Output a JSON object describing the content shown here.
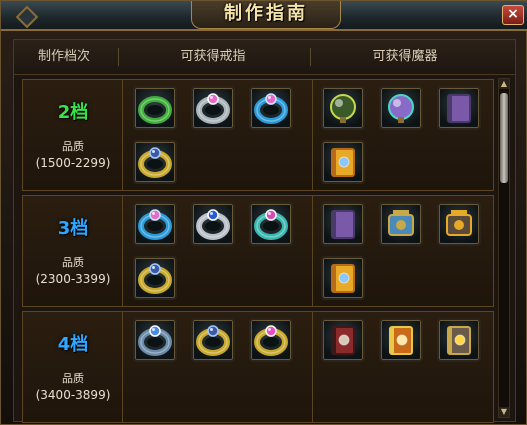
{
  "window": {
    "title": "制作指南",
    "close_label": "×"
  },
  "header": {
    "col_tier": "制作档次",
    "col_rings": "可获得戒指",
    "col_artifacts": "可获得魔器"
  },
  "tiers": [
    {
      "name": "2档",
      "color": "#3ce04a",
      "quality_label": "品质",
      "range": "(1500-2299)",
      "rings": [
        "green-ring-icon",
        "pink-gem-ring-icon",
        "blue-gem-ring-icon",
        "gold-blue-ring-icon"
      ],
      "artifacts": [
        "scepter-orb-icon",
        "purple-orb-icon",
        "purple-tome-icon",
        "golden-tome-icon"
      ]
    },
    {
      "name": "3档",
      "color": "#2fa6ff",
      "quality_label": "品质",
      "range": "(2300-3399)",
      "rings": [
        "blue-gem-ring-icon",
        "sapphire-ring-icon",
        "pink-stone-ring-icon",
        "gold-blue-ring-icon"
      ],
      "artifacts": [
        "purple-tome-icon",
        "blue-clockwork-icon",
        "golden-lantern-icon",
        "golden-tome-icon"
      ]
    },
    {
      "name": "4档",
      "color": "#2fa6ff",
      "quality_label": "品质",
      "range": "(3400-3899)",
      "rings": [
        "blue-diamond-ring-icon",
        "gold-blue-ring-icon",
        "pink-crown-ring-icon"
      ],
      "artifacts": [
        "skull-tome-icon",
        "glowing-tome-icon",
        "radiant-book-icon"
      ]
    }
  ]
}
